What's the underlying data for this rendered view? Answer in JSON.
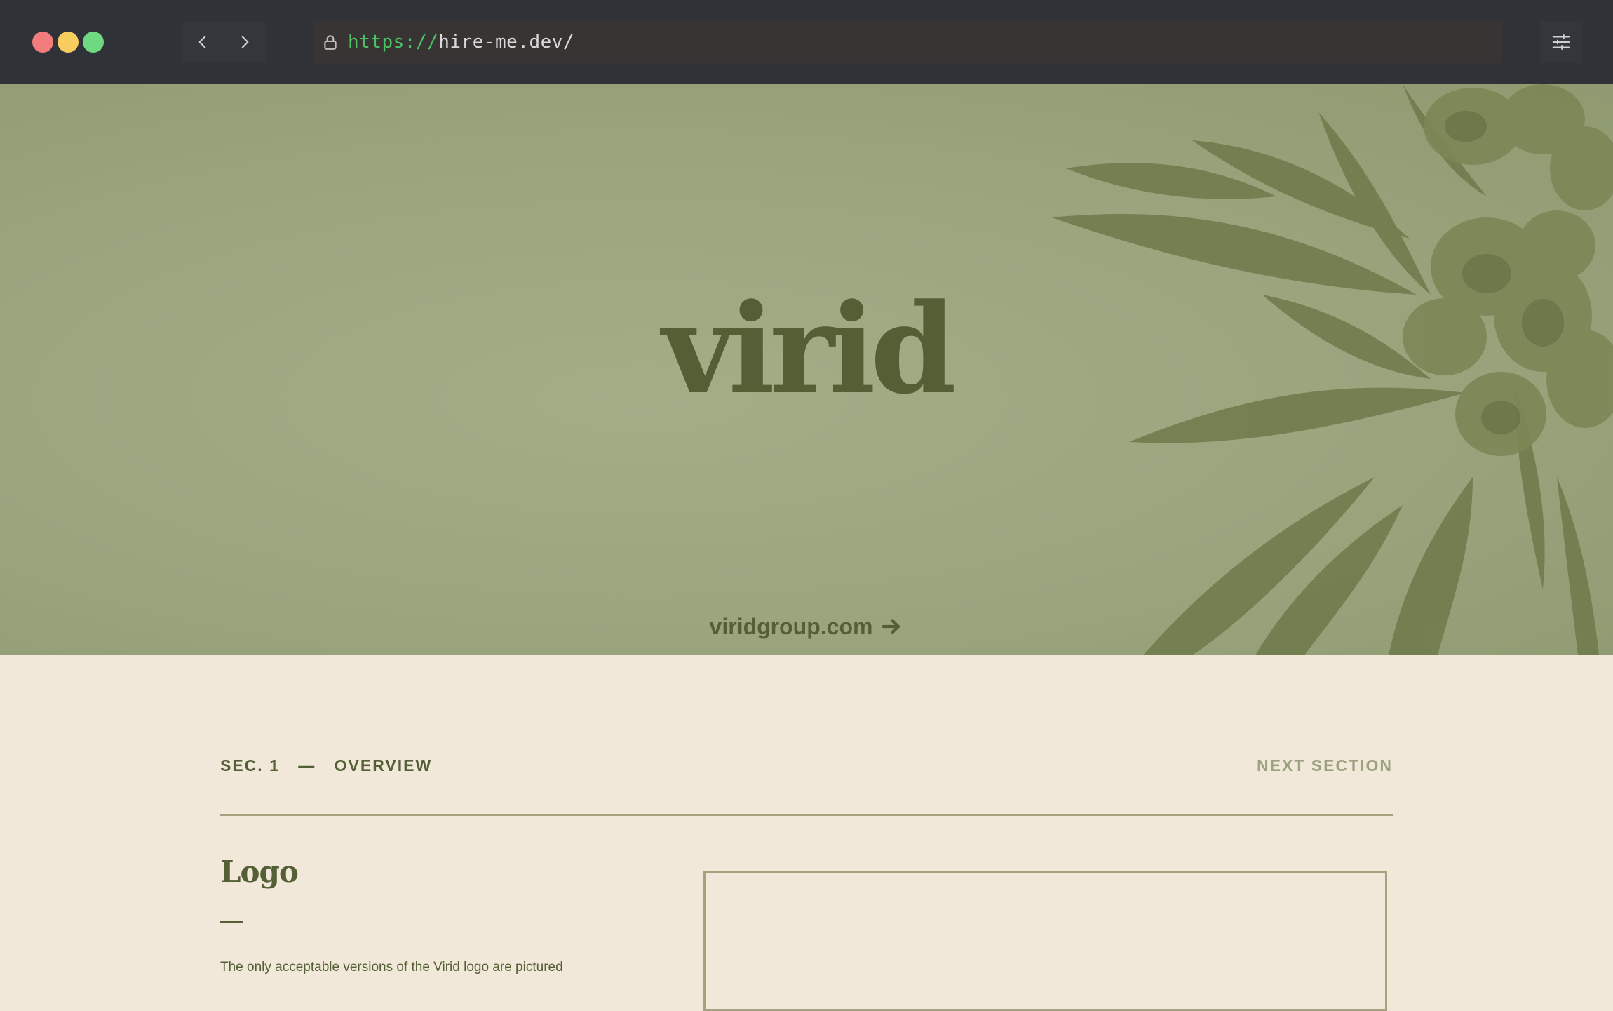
{
  "browser": {
    "url_scheme": "https://",
    "url_host": "hire-me.dev/",
    "icons": {
      "back": "chevron-left-icon",
      "forward": "chevron-right-icon",
      "lock": "lock-icon",
      "settings": "sliders-icon"
    }
  },
  "hero": {
    "logo_text": "virid",
    "link_text": "viridgroup.com",
    "link_icon": "arrow-right-icon"
  },
  "section": {
    "number_label": "SEC. 1",
    "separator": "—",
    "title": "OVERVIEW",
    "next_label": "NEXT SECTION"
  },
  "logo_section": {
    "heading": "Logo",
    "description": "The only acceptable versions of the Virid logo are pictured"
  },
  "colors": {
    "chrome_bg": "#2f3337",
    "hero_bg": "#9aa47d",
    "brand_green": "#545f35",
    "page_bg": "#f1e8da",
    "rule": "#a6a27f",
    "muted_green": "#9ca27f",
    "url_scheme": "#4cc266"
  }
}
